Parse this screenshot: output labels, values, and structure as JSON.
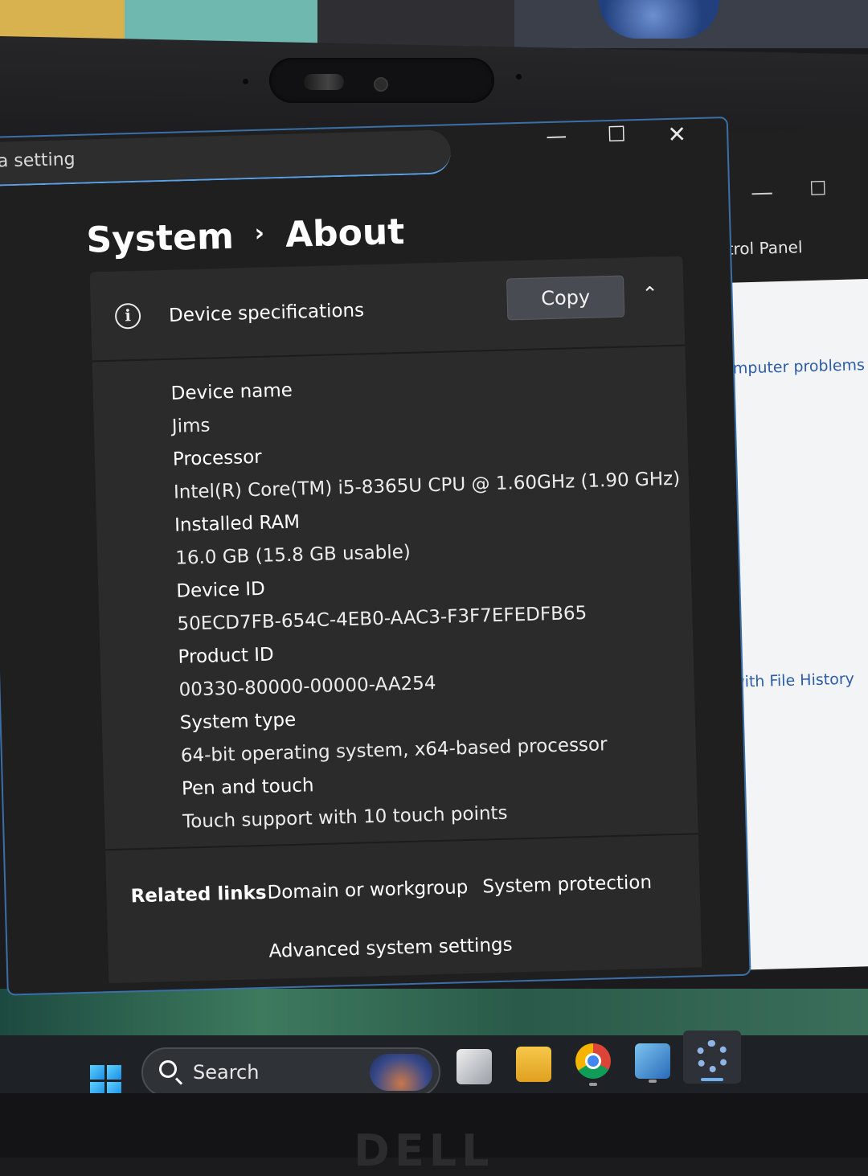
{
  "search": {
    "text": "a setting"
  },
  "window_controls": {
    "minimize": "—",
    "maximize": "☐",
    "close": "✕"
  },
  "breadcrumb": {
    "parent": "System",
    "separator": "›",
    "current": "About"
  },
  "device_specs": {
    "title": "Device specifications",
    "copy_label": "Copy",
    "collapse_glyph": "⌃",
    "items": [
      {
        "label": "Device name",
        "value": "Jims"
      },
      {
        "label": "Processor",
        "value": "Intel(R) Core(TM) i5-8365U CPU @ 1.60GHz (1.90 GHz)"
      },
      {
        "label": "Installed RAM",
        "value": "16.0 GB (15.8 GB usable)"
      },
      {
        "label": "Device ID",
        "value": "50ECD7FB-654C-4EB0-AAC3-F3F7EFEDFB65"
      },
      {
        "label": "Product ID",
        "value": "00330-80000-00000-AA254"
      },
      {
        "label": "System type",
        "value": "64-bit operating system, x64-based processor"
      },
      {
        "label": "Pen and touch",
        "value": "Touch support with 10 touch points"
      }
    ]
  },
  "related": {
    "label": "Related links",
    "links": [
      "Domain or workgroup",
      "System protection",
      "Advanced system settings"
    ]
  },
  "background_window": {
    "title": "ntrol Panel",
    "links": [
      "omputer problems",
      "with File History"
    ]
  },
  "taskbar": {
    "search_label": "Search"
  },
  "icons": {
    "info": "info-icon",
    "start": "windows-start-icon",
    "search": "search-icon",
    "task_view": "task-view-icon",
    "file_explorer": "file-explorer-icon",
    "chrome": "chrome-icon",
    "control_panel": "control-panel-icon",
    "settings": "settings-gear-icon"
  },
  "colors": {
    "accent": "#5aa0e6",
    "window_bg": "#1f1f20",
    "card_bg": "#2b2b2b"
  }
}
